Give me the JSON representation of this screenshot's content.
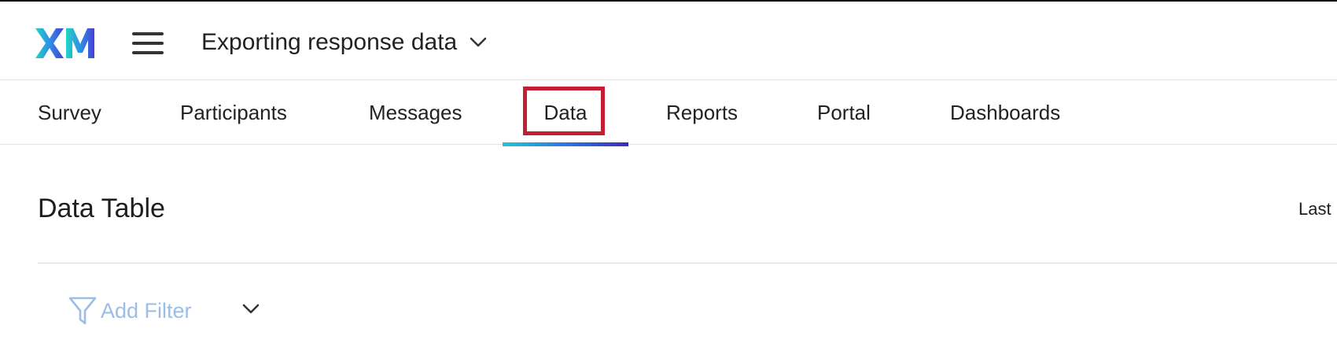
{
  "header": {
    "logo_text": "XM",
    "project_title": "Exporting response data"
  },
  "tabs": [
    {
      "label": "Survey",
      "active": false
    },
    {
      "label": "Participants",
      "active": false
    },
    {
      "label": "Messages",
      "active": false
    },
    {
      "label": "Data",
      "active": true
    },
    {
      "label": "Reports",
      "active": false
    },
    {
      "label": "Portal",
      "active": false
    },
    {
      "label": "Dashboards",
      "active": false
    }
  ],
  "content": {
    "title": "Data Table",
    "right_label": "Last",
    "filter_label": "Add Filter"
  },
  "colors": {
    "highlight_box": "#c21f32",
    "tab_underline_start": "#21c5d6",
    "tab_underline_end": "#3a2fb0",
    "filter_text": "#9cbde6"
  },
  "icons": {
    "logo": "xm-logo",
    "menu": "hamburger-menu-icon",
    "project_dropdown": "chevron-down-icon",
    "filter": "funnel-icon",
    "filter_dropdown": "chevron-down-icon"
  }
}
